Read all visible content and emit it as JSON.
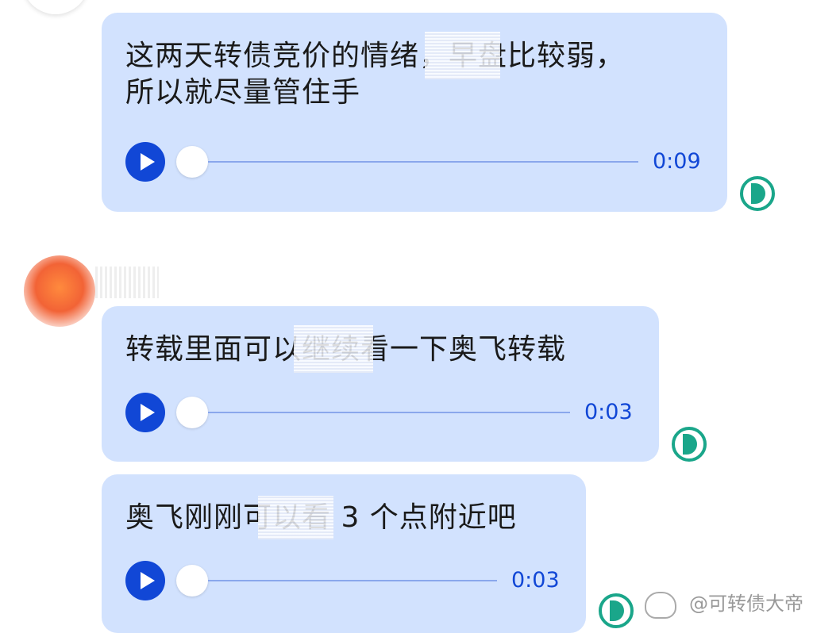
{
  "messages": [
    {
      "text": "这两天转债竞价的情绪，早盘比较弱，\n所以就尽量管住手",
      "duration": "0:09"
    },
    {
      "text": "转载里面可以继续看一下奥飞转载",
      "duration": "0:03"
    },
    {
      "text": "奥飞刚刚可以看 3 个点附近吧",
      "duration": "0:03"
    }
  ],
  "watermark": "@可转债大帝",
  "colors": {
    "bubble": "#d2e2fe",
    "accent": "#1147d6",
    "status": "#1aa68a"
  }
}
